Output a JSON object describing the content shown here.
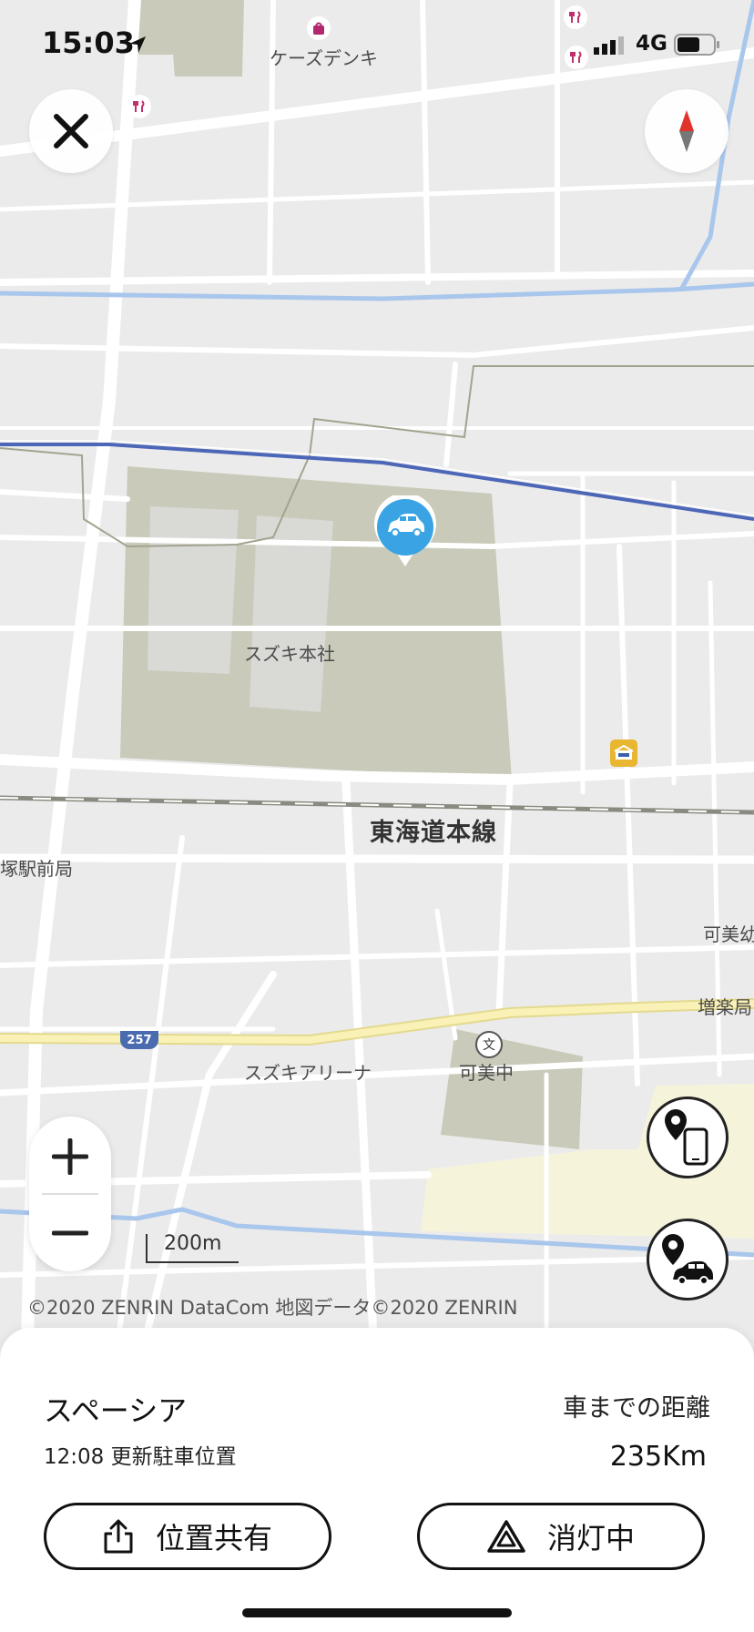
{
  "status_bar": {
    "time": "15:03",
    "network": "4G"
  },
  "map": {
    "labels": {
      "kz_denki": "ケーズデンキ",
      "suzuki_hq": "スズキ本社",
      "tokaido": "東海道本線",
      "station_front": "塚駅前局",
      "kamiyo": "可美幼",
      "masuraku": "増楽局",
      "suzuki_arena": "スズキアリーナ",
      "kami_chu": "可美中",
      "route": "257",
      "school_symbol": "文"
    },
    "scale_label": "200m",
    "copyright": "©2020  ZENRIN  DataCom    地図データ©2020  ZENRIN",
    "colors": {
      "marker": "#3aa3e3",
      "site": "#c9cab9",
      "rail_blue": "#4c66b8",
      "road_yellow": "#f7efb0"
    }
  },
  "controls": {
    "close_icon": "close-icon",
    "compass_icon": "compass-icon",
    "zoom_in": "+",
    "zoom_out": "−",
    "locate_phone_icon": "phone-location-icon",
    "locate_car_icon": "car-location-icon"
  },
  "sheet": {
    "car_name": "スペーシア",
    "updated": "12:08 更新駐車位置",
    "distance_label": "車までの距離",
    "distance": "235Km",
    "share_label": "位置共有",
    "hazard_label": "消灯中"
  }
}
